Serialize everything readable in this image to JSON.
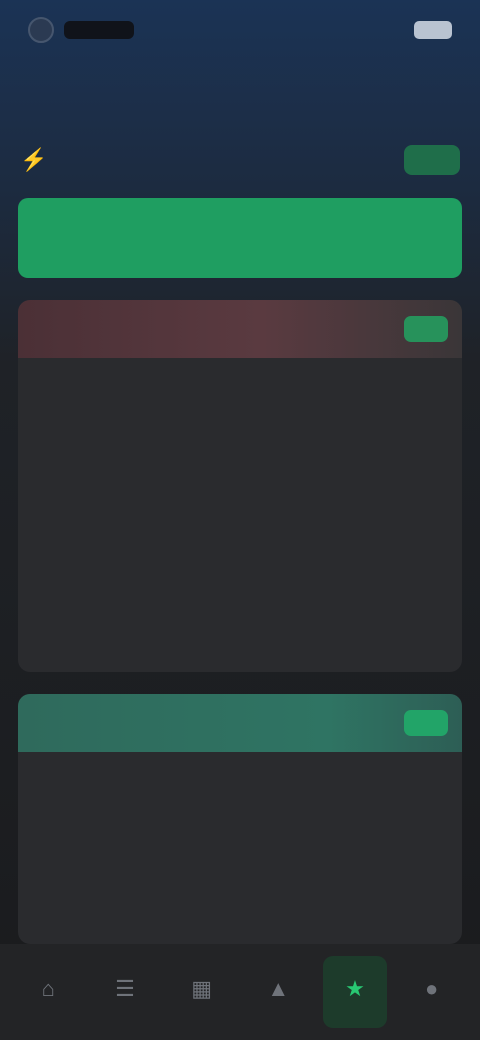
{
  "status_bar": {
    "brand": "",
    "time": ""
  },
  "header": {
    "title": ""
  },
  "promo": {
    "text": "",
    "badge": "",
    "icon": "lightning-icon"
  },
  "cta": {
    "label": ""
  },
  "cards": [
    {
      "title": "",
      "badge": "",
      "entries": [
        {
          "title": "",
          "text": ""
        },
        {
          "title": "",
          "text": ""
        },
        {
          "title": "",
          "text": ""
        }
      ]
    },
    {
      "title": "",
      "badge": "",
      "entries": [
        {
          "title": "",
          "text": ""
        },
        {
          "title": "",
          "text": ""
        }
      ]
    }
  ],
  "nav": {
    "active_index": 4,
    "items": [
      {
        "label": "",
        "icon": "home-icon"
      },
      {
        "label": "",
        "icon": "list-icon"
      },
      {
        "label": "",
        "icon": "grid-icon"
      },
      {
        "label": "",
        "icon": "chart-icon"
      },
      {
        "label": "",
        "icon": "star-icon"
      },
      {
        "label": "",
        "icon": "profile-icon"
      }
    ]
  },
  "colors": {
    "accent": "#1f9e61",
    "header_bg": "#1b3355",
    "card_bg": "#2a2b2e"
  }
}
